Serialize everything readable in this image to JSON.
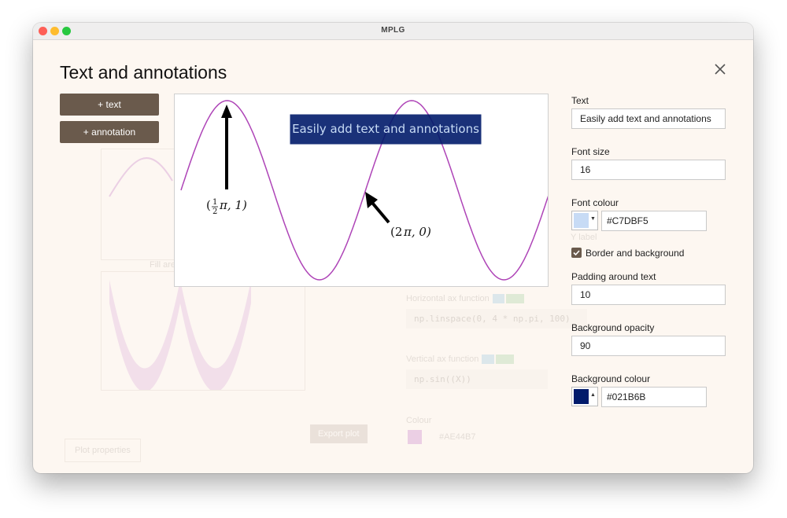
{
  "window": {
    "title": "MPLG"
  },
  "background_app": {
    "horizontal_label": "Horizontal ax function",
    "horizontal_code": "np.linspace(0, 4 * np.pi, 100)",
    "vertical_label": "Vertical ax function",
    "vertical_code": "np.sin((X))",
    "colour_label": "Colour",
    "colour_hex": "#AE44B7",
    "export_label": "Export plot",
    "plot_properties_label": "Plot properties",
    "fill_label": "Fill area",
    "y_label_ghost": "Y label"
  },
  "modal": {
    "title": "Text and annotations",
    "add_text_label": "+ text",
    "add_annotation_label": "+ annotation"
  },
  "preview": {
    "text_box": "Easily add text and annotations",
    "curve_color": "#AE44B7",
    "text_bg_color": "#021B6B",
    "text_color": "#C7DBF5"
  },
  "panel": {
    "text_label": "Text",
    "text_value": "Easily add text and annotations",
    "font_size_label": "Font size",
    "font_size_value": "16",
    "font_colour_label": "Font colour",
    "font_colour_hex": "#C7DBF5",
    "border_label": "Border and background",
    "border_checked": true,
    "padding_label": "Padding around text",
    "padding_value": "10",
    "opacity_label": "Background opacity",
    "opacity_value": "90",
    "bg_colour_label": "Background colour",
    "bg_colour_hex": "#021B6B"
  }
}
